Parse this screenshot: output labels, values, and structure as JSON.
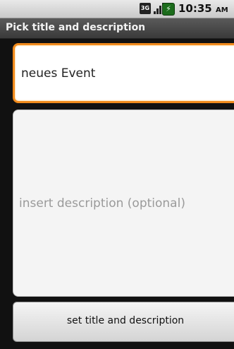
{
  "status_bar": {
    "time": "10:35",
    "ampm": "AM",
    "network_label": "3G",
    "icons": [
      "network-3g-icon",
      "signal-strength-icon",
      "battery-icon"
    ]
  },
  "title_bar": {
    "title": "Pick title and description"
  },
  "form": {
    "title_value": "neues Event",
    "description_placeholder": "insert description (optional)",
    "submit_label": "set title and description"
  },
  "colors": {
    "focus_border": "#f08a1c",
    "titlebar_bg": "#4a4a4a",
    "background": "#000000"
  }
}
